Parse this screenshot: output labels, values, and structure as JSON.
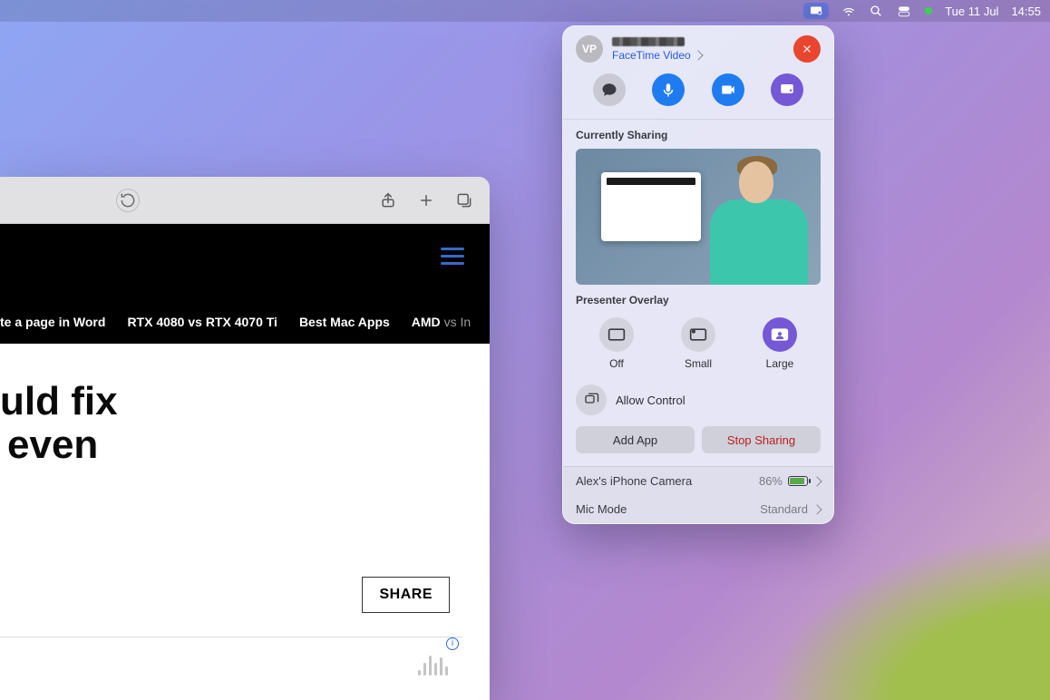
{
  "menubar": {
    "date": "Tue 11 Jul",
    "time": "14:55"
  },
  "safari": {
    "tags": [
      "te a page in Word",
      "RTX 4080 vs RTX 4070 Ti",
      "Best Mac Apps",
      "AMD",
      "vs In"
    ],
    "headline_line1": "uld fix",
    "headline_line2": "even",
    "share_label": "SHARE"
  },
  "hud": {
    "avatar_initials": "VP",
    "call_type": "FaceTime Video",
    "sharing_label": "Currently Sharing",
    "overlay_label": "Presenter Overlay",
    "overlay_options": {
      "off": "Off",
      "small": "Small",
      "large": "Large"
    },
    "allow_control": "Allow Control",
    "add_app": "Add App",
    "stop_sharing": "Stop Sharing",
    "camera_label": "Alex's iPhone Camera",
    "battery_pct": "86%",
    "mic_mode_label": "Mic Mode",
    "mic_mode_value": "Standard"
  }
}
